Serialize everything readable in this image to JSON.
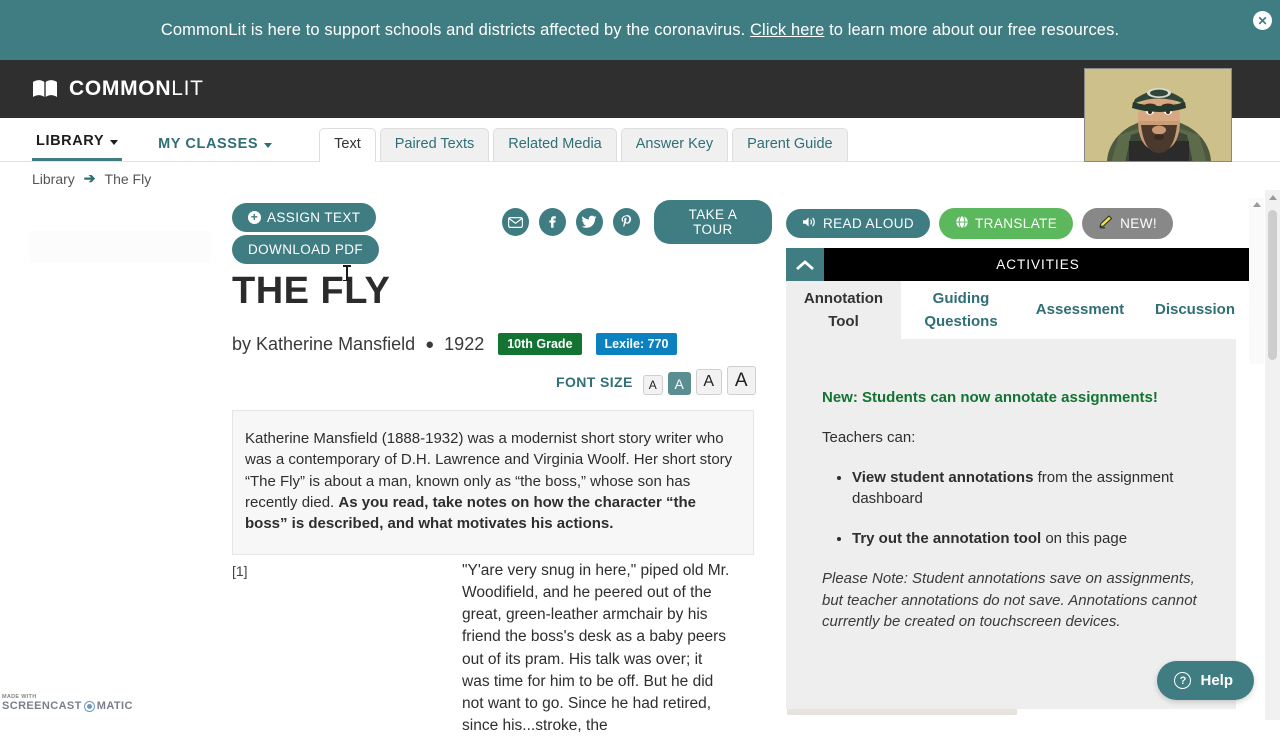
{
  "banner": {
    "text_before": "CommonLit is here to support schools and districts affected by the coronavirus. ",
    "link_text": "Click here",
    "text_after": " to learn more about our free resources.",
    "close_label": "✕",
    "bg_color": "#3f7d83"
  },
  "topnav": {
    "brand_bold": "COMMON",
    "brand_light": "LIT",
    "search_icon": "search-icon",
    "bg_color": "#2f2f2f"
  },
  "subnav": {
    "items": [
      {
        "label": "LIBRARY",
        "active": true
      },
      {
        "label": "MY CLASSES",
        "active": false
      }
    ],
    "tabs": [
      {
        "label": "Text",
        "active": true
      },
      {
        "label": "Paired Texts",
        "active": false
      },
      {
        "label": "Related Media",
        "active": false
      },
      {
        "label": "Answer Key",
        "active": false
      },
      {
        "label": "Parent Guide",
        "active": false
      }
    ]
  },
  "breadcrumb": {
    "root": "Library",
    "arrow": "➔",
    "current": "The Fly"
  },
  "article": {
    "assign_label": "ASSIGN TEXT",
    "download_label": "DOWNLOAD PDF",
    "favorite_icon": "heart-plus-icon",
    "social": [
      {
        "name": "email-icon",
        "glyph": "✉"
      },
      {
        "name": "facebook-icon",
        "glyph": "f"
      },
      {
        "name": "twitter-icon",
        "glyph": "🐦"
      },
      {
        "name": "pinterest-icon",
        "glyph": "P"
      }
    ],
    "tour_label": "TAKE A TOUR",
    "title": "THE FLY",
    "author_line": "by Katherine Mansfield",
    "separator": "●",
    "year": "1922",
    "grade_badge": "10th Grade",
    "grade_badge_color": "#137333",
    "lexile_badge": "Lexile: 770",
    "lexile_badge_color": "#0b82bf",
    "font_size_label": "FONT SIZE",
    "font_size_options": [
      "A",
      "A",
      "A",
      "A"
    ],
    "font_size_selected_index": 1,
    "intro_plain": "Katherine Mansfield (1888-1932) was a modernist short story writer who was a contemporary of D.H. Lawrence and Virginia Woolf. Her short story “The Fly” is about a man, known only as “the boss,” whose son has recently died. ",
    "intro_bold": "As you read, take notes on how the character “the boss” is described, and what motivates his actions.",
    "paragraph_number": "[1]",
    "paragraph_text": "\"Y'are very snug in here,\" piped old Mr. Woodifield, and he peered out of the great, green-leather armchair by his friend the boss's desk as a baby peers out of its pram. His talk was over; it was time for him to be off. But he did not want to go. Since he had retired, since his...stroke, the",
    "image_alt": "green-bottle-fly-photo"
  },
  "activities": {
    "read_aloud_label": "READ ALOUD",
    "read_aloud_icon": "speaker-icon",
    "translate_label": "TRANSLATE",
    "translate_icon": "globe-icon",
    "new_label": "NEW!",
    "new_icon": "pencil-icon",
    "read_aloud_color": "#3f7d83",
    "translate_color": "#5cb85c",
    "new_color": "#888888",
    "panel_title": "ACTIVITIES",
    "collapse_icon": "chevron-up-icon",
    "tabs": [
      {
        "label": "Annotation Tool",
        "active": true
      },
      {
        "label": "Guiding Questions",
        "active": false
      },
      {
        "label": "Assessment",
        "active": false
      },
      {
        "label": "Discussion",
        "active": false
      }
    ],
    "headline": "New: Students can now annotate assignments!",
    "subhead": "Teachers can:",
    "bullets": [
      {
        "bold": "View student annotations",
        "rest": " from the assignment dashboard"
      },
      {
        "bold": "Try out the annotation tool",
        "rest": " on this page"
      }
    ],
    "note": "Please Note: Student annotations save on assignments, but teacher annotations do not save. Annotations cannot currently be created on touchscreen devices."
  },
  "help": {
    "label": "Help",
    "icon": "question-mark-icon",
    "color": "#3f7d83"
  },
  "watermark": {
    "top": "MADE WITH",
    "left": "SCREENCAST",
    "right": "MATIC"
  }
}
